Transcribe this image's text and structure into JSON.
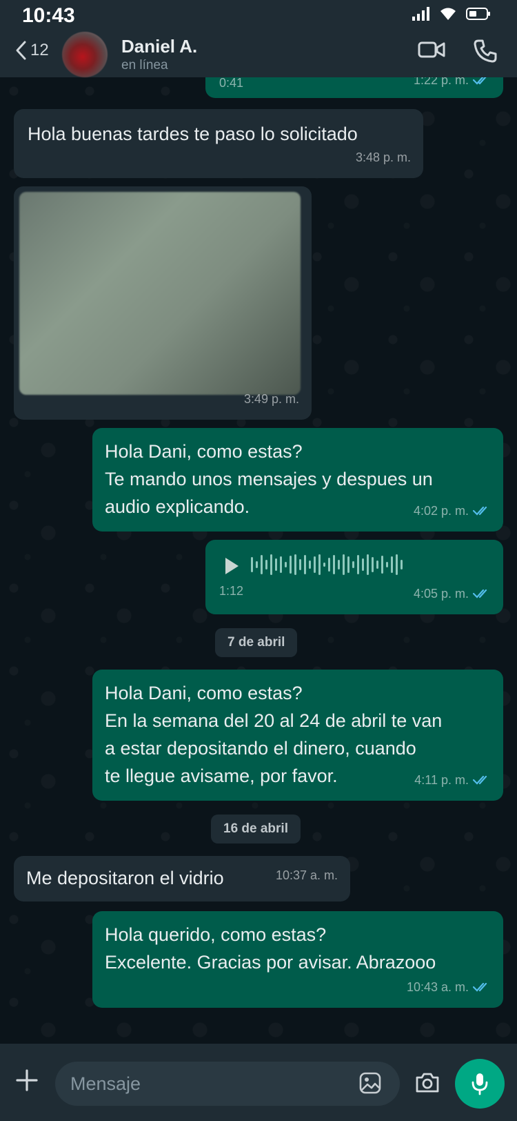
{
  "status_bar": {
    "time": "10:43"
  },
  "header": {
    "back_count": "12",
    "contact_name": "Daniel A.",
    "contact_status": "en línea"
  },
  "messages": [
    {
      "id": "m0",
      "direction": "out",
      "type": "audio",
      "duration": "0:41",
      "time": "1:22 p. m.",
      "read": true,
      "partial": true
    },
    {
      "id": "m1",
      "direction": "in",
      "type": "text",
      "text": "Hola buenas tardes te paso lo solicitado",
      "time": "3:48 p. m."
    },
    {
      "id": "m2",
      "direction": "in",
      "type": "image",
      "time": "3:49 p. m."
    },
    {
      "id": "m3",
      "direction": "out",
      "type": "text",
      "lines": [
        "Hola Dani, como estas?",
        "Te mando unos mensajes y despues un",
        "audio explicando."
      ],
      "time": "4:02 p. m.",
      "read": true
    },
    {
      "id": "m4",
      "direction": "out",
      "type": "audio",
      "duration": "1:12",
      "time": "4:05 p. m.",
      "read": true
    },
    {
      "id": "m5",
      "direction": "out",
      "type": "text",
      "lines": [
        "Hola Dani, como estas?",
        "En la semana del 20 al 24 de abril te van",
        "a estar depositando el dinero, cuando",
        "te llegue avisame, por favor."
      ],
      "time": "4:11 p. m.",
      "read": true
    },
    {
      "id": "m6",
      "direction": "in",
      "type": "text",
      "text": "Me depositaron el vidrio",
      "time": "10:37 a. m."
    },
    {
      "id": "m7",
      "direction": "out",
      "type": "text",
      "lines": [
        "Hola querido, como estas?",
        "Excelente. Gracias por avisar. Abrazooo"
      ],
      "time": "10:43 a. m.",
      "read": true
    }
  ],
  "date_separators": [
    "7 de abril",
    "16 de abril"
  ],
  "composer": {
    "placeholder": "Mensaje"
  },
  "icons": {
    "back": "chevron-left-icon",
    "video": "video-camera-icon",
    "call": "phone-icon",
    "attach": "plus-icon",
    "sticker": "sticker-icon",
    "camera": "camera-icon",
    "mic": "microphone-icon",
    "play": "play-icon",
    "read": "double-check-icon"
  },
  "colors": {
    "header_bg": "#1f2c34",
    "chat_bg": "#0b141a",
    "incoming_bubble": "#1f2c34",
    "outgoing_bubble": "#005c4b",
    "read_ticks": "#53bdeb",
    "accent": "#00a884"
  }
}
